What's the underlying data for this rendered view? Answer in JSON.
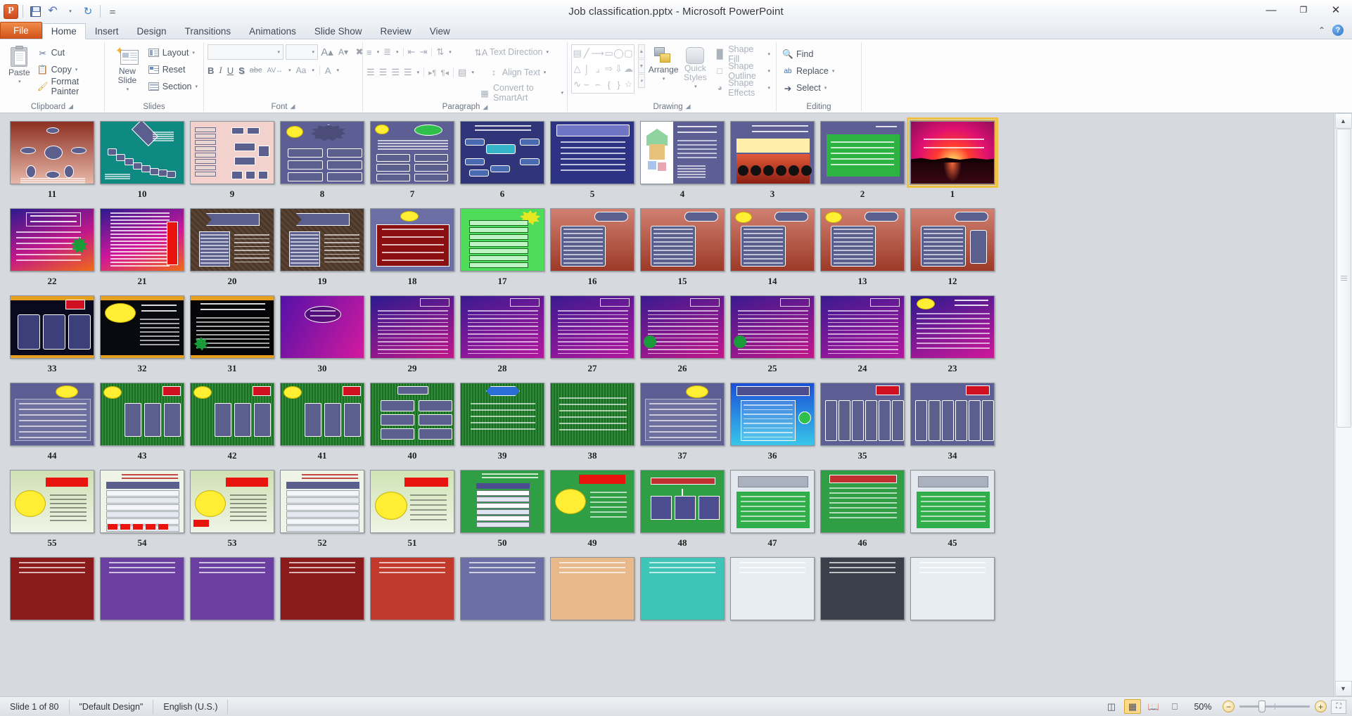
{
  "window": {
    "title": "Job classification.pptx  -  Microsoft PowerPoint",
    "app_logo": "P",
    "minimize": "—",
    "restore": "❐",
    "close": "✕"
  },
  "quick_access": {
    "items": [
      {
        "name": "save-icon",
        "label": "Save"
      },
      {
        "name": "undo-icon",
        "label": "↶"
      },
      {
        "name": "undo-dropdown-icon",
        "label": "▾"
      },
      {
        "name": "redo-icon",
        "label": "↻"
      },
      {
        "name": "customize-qat-icon",
        "label": "▾"
      }
    ]
  },
  "tabs": [
    {
      "label": "File",
      "id": "file"
    },
    {
      "label": "Home",
      "id": "home"
    },
    {
      "label": "Insert",
      "id": "insert"
    },
    {
      "label": "Design",
      "id": "design"
    },
    {
      "label": "Transitions",
      "id": "transitions"
    },
    {
      "label": "Animations",
      "id": "animations"
    },
    {
      "label": "Slide Show",
      "id": "slideshow"
    },
    {
      "label": "Review",
      "id": "review"
    },
    {
      "label": "View",
      "id": "view"
    }
  ],
  "tab_right": {
    "collapse_ribbon": "⌃",
    "help": "?"
  },
  "ribbon": {
    "groups": [
      {
        "label": "Clipboard",
        "has_dialog_launcher": true,
        "paste": "Paste",
        "items": [
          {
            "label": "Cut",
            "icon": "scissors-icon",
            "dropdown": false
          },
          {
            "label": "Copy",
            "icon": "copy-icon",
            "dropdown": true
          },
          {
            "label": "Format Painter",
            "icon": "format-painter-icon",
            "dropdown": false
          }
        ]
      },
      {
        "label": "Slides",
        "has_dialog_launcher": false,
        "new_slide": "New\nSlide",
        "items": [
          {
            "label": "Layout",
            "icon": "layout-icon",
            "dropdown": true
          },
          {
            "label": "Reset",
            "icon": "reset-icon",
            "dropdown": false
          },
          {
            "label": "Section",
            "icon": "section-icon",
            "dropdown": true
          }
        ]
      },
      {
        "label": "Font",
        "has_dialog_launcher": true,
        "font_name": "",
        "font_size": "",
        "buttons_row1": [
          "grow-font-icon",
          "shrink-font-icon",
          "clear-formatting-icon"
        ],
        "buttons_row2": [
          "B",
          "I",
          "U",
          "S",
          "abc",
          "AV",
          "Aa",
          "A"
        ]
      },
      {
        "label": "Paragraph",
        "has_dialog_launcher": true,
        "items": [
          {
            "label": "Text Direction",
            "icon": "text-direction-icon",
            "dropdown": true
          },
          {
            "label": "Align Text",
            "icon": "align-text-icon",
            "dropdown": true
          },
          {
            "label": "Convert to SmartArt",
            "icon": "smartart-icon",
            "dropdown": true
          }
        ]
      },
      {
        "label": "Drawing",
        "has_dialog_launcher": true,
        "arrange": "Arrange",
        "quick_styles": "Quick\nStyles",
        "items": [
          {
            "label": "Shape Fill",
            "icon": "shape-fill-icon",
            "dropdown": true
          },
          {
            "label": "Shape Outline",
            "icon": "shape-outline-icon",
            "dropdown": true
          },
          {
            "label": "Shape Effects",
            "icon": "shape-effects-icon",
            "dropdown": true
          }
        ]
      },
      {
        "label": "Editing",
        "has_dialog_launcher": false,
        "items": [
          {
            "label": "Find",
            "icon": "find-icon",
            "dropdown": false
          },
          {
            "label": "Replace",
            "icon": "replace-icon",
            "dropdown": true
          },
          {
            "label": "Select",
            "icon": "select-icon",
            "dropdown": true
          }
        ]
      }
    ]
  },
  "status_bar": {
    "slide_info": "Slide 1 of 80",
    "theme": "\"Default Design\"",
    "language": "English (U.S.)",
    "views": [
      {
        "name": "normal-view-button",
        "glyph": "▣",
        "active": false
      },
      {
        "name": "slide-sorter-view-button",
        "glyph": "▒",
        "active": true
      },
      {
        "name": "reading-view-button",
        "glyph": "◫",
        "active": false
      },
      {
        "name": "slide-show-button",
        "glyph": "▱",
        "active": false
      }
    ],
    "zoom": "50%",
    "zoom_out": "−",
    "zoom_in": "+",
    "fit_to_window": "fit-slide-icon"
  },
  "slides": {
    "total": 80,
    "selected": 1,
    "rows": [
      {
        "cells": [
          {
            "num": "11",
            "bg": "linear-gradient(#8c2f22,#e8b8a8)",
            "kind": "radial-diagram"
          },
          {
            "num": "10",
            "bg": "#0e8a82",
            "kind": "flow-teal"
          },
          {
            "num": "9",
            "bg": "#f3d2cd",
            "kind": "orgchart-pink"
          },
          {
            "num": "8",
            "bg": "#5d5f94",
            "kind": "boxes-cloud"
          },
          {
            "num": "7",
            "bg": "#5d5f94",
            "kind": "jobanalysis"
          },
          {
            "num": "6",
            "bg": "#3a3f7a",
            "kind": "hr-functions"
          },
          {
            "num": "5",
            "bg": "#3b3f86",
            "kind": "hr-management"
          },
          {
            "num": "4",
            "bg": "#5d5f94",
            "kind": "organization"
          },
          {
            "num": "3",
            "bg": "#5d5f94",
            "kind": "human-resource"
          },
          {
            "num": "2",
            "bg": "#5d5f94",
            "kind": "intro-green"
          },
          {
            "num": "1",
            "bg": "linear-gradient(#b4155f,#e8162b 55%,#3a0a10)",
            "kind": "title-sunset",
            "selected": true
          }
        ]
      },
      {
        "cells": [
          {
            "num": "22",
            "bg": "linear-gradient(160deg,#2b1b8f,#c2178a 55%,#f06a17)",
            "kind": "paq-text"
          },
          {
            "num": "21",
            "bg": "linear-gradient(160deg,#2b1b8f,#d0179a 55%,#f06a17)",
            "kind": "methods-list"
          },
          {
            "num": "20",
            "bg": "#5a4333",
            "kind": "job-spec"
          },
          {
            "num": "19",
            "bg": "#5a4333",
            "kind": "job-desc"
          },
          {
            "num": "18",
            "bg": "#6b6fa3",
            "kind": "note-dark-red"
          },
          {
            "num": "17",
            "bg": "#4fdc5a",
            "kind": "green-table"
          },
          {
            "num": "16",
            "bg": "linear-gradient(#cf7f70,#9d3a28)",
            "kind": "redbox-a"
          },
          {
            "num": "15",
            "bg": "linear-gradient(#cf7f70,#9d3a28)",
            "kind": "redbox-b"
          },
          {
            "num": "14",
            "bg": "linear-gradient(#cf7f70,#9d3a28)",
            "kind": "redbox-c"
          },
          {
            "num": "13",
            "bg": "linear-gradient(#cf7f70,#9d3a28)",
            "kind": "redbox-d"
          },
          {
            "num": "12",
            "bg": "linear-gradient(#cf7f70,#9d3a28)",
            "kind": "redbox-e"
          }
        ]
      },
      {
        "cells": [
          {
            "num": "33",
            "bg": "#0a0a1e",
            "kind": "dark-cards"
          },
          {
            "num": "32",
            "bg": "#08080f",
            "kind": "aet-intro"
          },
          {
            "num": "31",
            "bg": "#050507",
            "kind": "ergonomic"
          },
          {
            "num": "30",
            "bg": "linear-gradient(120deg,#5411a8,#d41a9e)",
            "kind": "purple-oval"
          },
          {
            "num": "29",
            "bg": "linear-gradient(160deg,#2b1b8f,#c2178a)",
            "kind": "list-29"
          },
          {
            "num": "28",
            "bg": "linear-gradient(160deg,#3a1a90,#b5179e)",
            "kind": "list-28"
          },
          {
            "num": "27",
            "bg": "linear-gradient(160deg,#3a1a90,#b5179e)",
            "kind": "list-27"
          },
          {
            "num": "26",
            "bg": "linear-gradient(160deg,#3a1a90,#c2178a)",
            "kind": "list-26"
          },
          {
            "num": "25",
            "bg": "linear-gradient(160deg,#3a1a90,#c2178a)",
            "kind": "list-25"
          },
          {
            "num": "24",
            "bg": "linear-gradient(160deg,#3a1a90,#b5179e)",
            "kind": "list-24"
          },
          {
            "num": "23",
            "bg": "linear-gradient(160deg,#2b1b8f,#d0179a)",
            "kind": "paq-method"
          }
        ]
      },
      {
        "cells": [
          {
            "num": "44",
            "bg": "#5d5f94",
            "kind": "note-44"
          },
          {
            "num": "43",
            "bg": "#1e6b28",
            "kind": "grass-43"
          },
          {
            "num": "42",
            "bg": "#1e6b28",
            "kind": "grass-42"
          },
          {
            "num": "41",
            "bg": "#1e6b28",
            "kind": "grass-41"
          },
          {
            "num": "40",
            "bg": "#1e6b28",
            "kind": "grass-40"
          },
          {
            "num": "39",
            "bg": "#1e6b28",
            "kind": "grass-39"
          },
          {
            "num": "38",
            "bg": "#1e6b28",
            "kind": "grass-38"
          },
          {
            "num": "37",
            "bg": "#5d5f94",
            "kind": "note-37"
          },
          {
            "num": "36",
            "bg": "linear-gradient(#1b4fd6,#39c6ea)",
            "kind": "fja-blue"
          },
          {
            "num": "35",
            "bg": "#5d5f94",
            "kind": "table-35"
          },
          {
            "num": "34",
            "bg": "#5d5f94",
            "kind": "table-34"
          }
        ]
      },
      {
        "cells": [
          {
            "num": "55",
            "bg": "linear-gradient(#dbe8c8,#eef3e4)",
            "kind": "green-55"
          },
          {
            "num": "54",
            "bg": "#eef3e4",
            "kind": "table-54"
          },
          {
            "num": "53",
            "bg": "linear-gradient(#dbe8c8,#eef3e4)",
            "kind": "green-53"
          },
          {
            "num": "52",
            "bg": "#eef3e4",
            "kind": "table-52"
          },
          {
            "num": "51",
            "bg": "linear-gradient(#cfe4b4,#eef3e4)",
            "kind": "green-51"
          },
          {
            "num": "50",
            "bg": "#2b8a3e",
            "kind": "table-50"
          },
          {
            "num": "49",
            "bg": "#2b8a3e",
            "kind": "green-49"
          },
          {
            "num": "48",
            "bg": "#2b8a3e",
            "kind": "chart-48"
          },
          {
            "num": "47",
            "bg": "#e8edf2",
            "kind": "gray-47"
          },
          {
            "num": "46",
            "bg": "#2b8a3e",
            "kind": "green-46"
          },
          {
            "num": "45",
            "bg": "#e8edf2",
            "kind": "gray-45"
          }
        ]
      },
      {
        "cells": [
          {
            "num": "",
            "bg": "#8b1b1b",
            "kind": "partial-a"
          },
          {
            "num": "",
            "bg": "#6b3fa0",
            "kind": "partial-b"
          },
          {
            "num": "",
            "bg": "#6b3fa0",
            "kind": "partial-c"
          },
          {
            "num": "",
            "bg": "#8b1b1b",
            "kind": "partial-d"
          },
          {
            "num": "",
            "bg": "#c0392b",
            "kind": "partial-e"
          },
          {
            "num": "",
            "bg": "#6b6fa3",
            "kind": "partial-f"
          },
          {
            "num": "",
            "bg": "#e8b98a",
            "kind": "partial-g"
          },
          {
            "num": "",
            "bg": "#3fc4b8",
            "kind": "partial-h"
          },
          {
            "num": "",
            "bg": "#e8edf2",
            "kind": "partial-i"
          },
          {
            "num": "",
            "bg": "#3a3f4a",
            "kind": "partial-j"
          },
          {
            "num": "",
            "bg": "#e8edf2",
            "kind": "partial-k"
          }
        ]
      }
    ]
  },
  "colors": {
    "accent_orange": "#d4541b",
    "selection_gold": "#f0c040",
    "ribbon_bg": "#fdfdfe",
    "workspace_bg": "#d6d9dd"
  }
}
